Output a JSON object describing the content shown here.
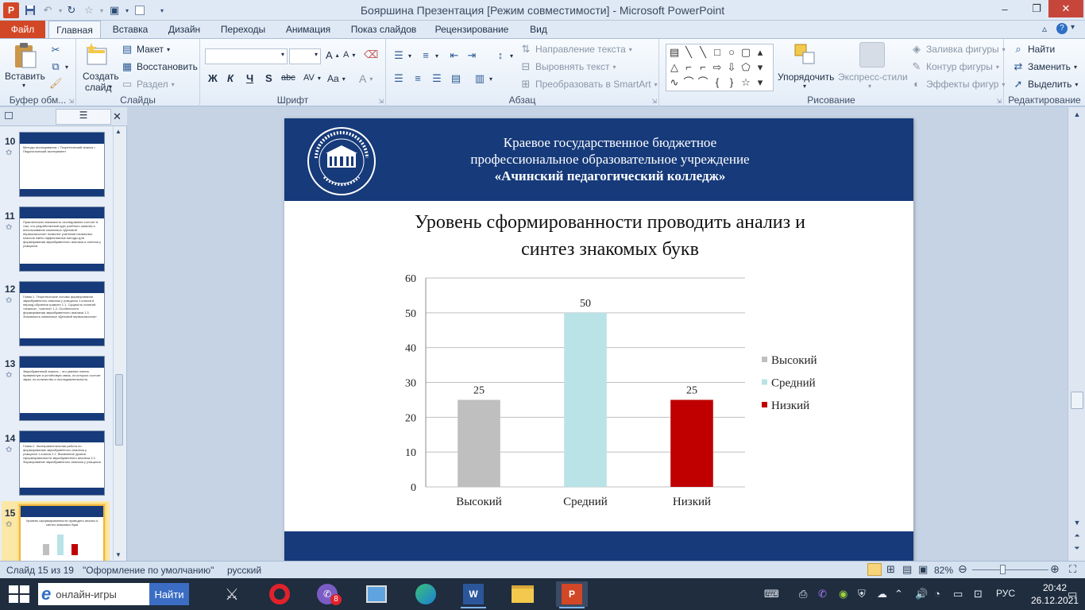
{
  "window": {
    "title": "Бояршина Презентация [Режим совместимости]  -  Microsoft PowerPoint",
    "app_logo": "P",
    "min_icon": "–",
    "max_icon": "❐",
    "close_icon": "✕"
  },
  "tabs": {
    "file": "Файл",
    "items": [
      "Главная",
      "Вставка",
      "Дизайн",
      "Переходы",
      "Анимация",
      "Показ слайдов",
      "Рецензирование",
      "Вид"
    ]
  },
  "ribbon": {
    "clipboard": {
      "label": "Буфер обм...",
      "paste": "Вставить"
    },
    "slides": {
      "label": "Слайды",
      "new_slide_line1": "Создать",
      "new_slide_line2": "слайд",
      "layout": "Макет",
      "reset": "Восстановить",
      "section": "Раздел"
    },
    "font": {
      "label": "Шрифт",
      "bold": "Ж",
      "italic": "К",
      "underline": "Ч",
      "shadow": "S",
      "strike": "abc",
      "spacing": "AV",
      "case": "Aa",
      "color": "A",
      "grow": "A",
      "shrink": "A"
    },
    "paragraph": {
      "label": "Абзац",
      "text_direction": "Направление текста",
      "align_text": "Выровнять текст",
      "smartart": "Преобразовать в SmartArt"
    },
    "drawing": {
      "label": "Рисование",
      "arrange": "Упорядочить",
      "quick_styles": "Экспресс-стили",
      "fill": "Заливка фигуры",
      "outline": "Контур фигуры",
      "effects": "Эффекты фигур"
    },
    "editing": {
      "label": "Редактирование",
      "find": "Найти",
      "replace": "Заменить",
      "select": "Выделить"
    }
  },
  "thumbnails": [
    {
      "num": "10",
      "text": "Методы исследования:\n• Теоретический анализ\n• Педагогический эксперимент"
    },
    {
      "num": "11",
      "text": "Практическая значимость исследования состоит в том, что разработанный курс учебного занятия и использование комплекса «Деловой первоклассник» позволит учителям начальных классов найти эффективные методы для формирования звукобуквенного анализа и синтеза у учащихся."
    },
    {
      "num": "12",
      "text": "Глава 1. Теоретические основы формирования звукобуквенного анализа у учащихся 1 класса в период обучения грамоте\n1.1. Сущность понятий «анализ», «синтез»\n1.2. Особенности формирования звукобуквенного анализа\n1.3. Значимость комплекса «Деловой первоклассник»"
    },
    {
      "num": "13",
      "text": "Звукобуквенный анализ – это умение понять правильную и устойчивую связь, из которых состоят звуки, их количество и последовательность."
    },
    {
      "num": "14",
      "text": "Глава 2. Экспериментальная работа по формированию звукобуквенного анализа у учащихся 1 класса\n2.1. Выявление уровня сформированности звукобуквенного анализа\n2.2. Формирование звукобуквенного анализа у учащихся"
    },
    {
      "num": "15",
      "text": "Уровень сформированности проводить анализ и синтез знакомых букв"
    }
  ],
  "slide": {
    "header_line1": "Краевое государственное бюджетное",
    "header_line2": "профессиональное образовательное учреждение",
    "header_line3": "«Ачинский педагогический колледж»",
    "logo_text": "АЧИНСКИЙ ПЕДАГОГИЧЕСКИЙ КОЛЛЕДЖ",
    "logo_motto": "УЧИТЬ. РАЗВИВАТЬ. ВОСПИТЫВАТЬ.",
    "logo_founded": "Основан в 1920г."
  },
  "chart_data": {
    "type": "bar",
    "title": "Уровень сформированности проводить анализ и синтез знакомых букв",
    "categories": [
      "Высокий",
      "Средний",
      "Низкий"
    ],
    "values": [
      25,
      50,
      25
    ],
    "colors": [
      "#bfbfbf",
      "#b9e3e6",
      "#c00000"
    ],
    "ylim": [
      0,
      60
    ],
    "yticks": [
      0,
      10,
      20,
      30,
      40,
      50,
      60
    ],
    "legend": [
      "Высокий",
      "Средний",
      "Низкий"
    ],
    "legend_position": "right",
    "grid": true
  },
  "status": {
    "slide": "Слайд 15 из 19",
    "theme": "\"Оформление по умолчанию\"",
    "lang": "русский",
    "zoom": "82%"
  },
  "taskbar": {
    "search_placeholder": "онлайн-игры",
    "search_button": "Найти",
    "viber_badge": "8",
    "lang": "РУС",
    "time": "20:42",
    "date": "26.12.2021"
  }
}
